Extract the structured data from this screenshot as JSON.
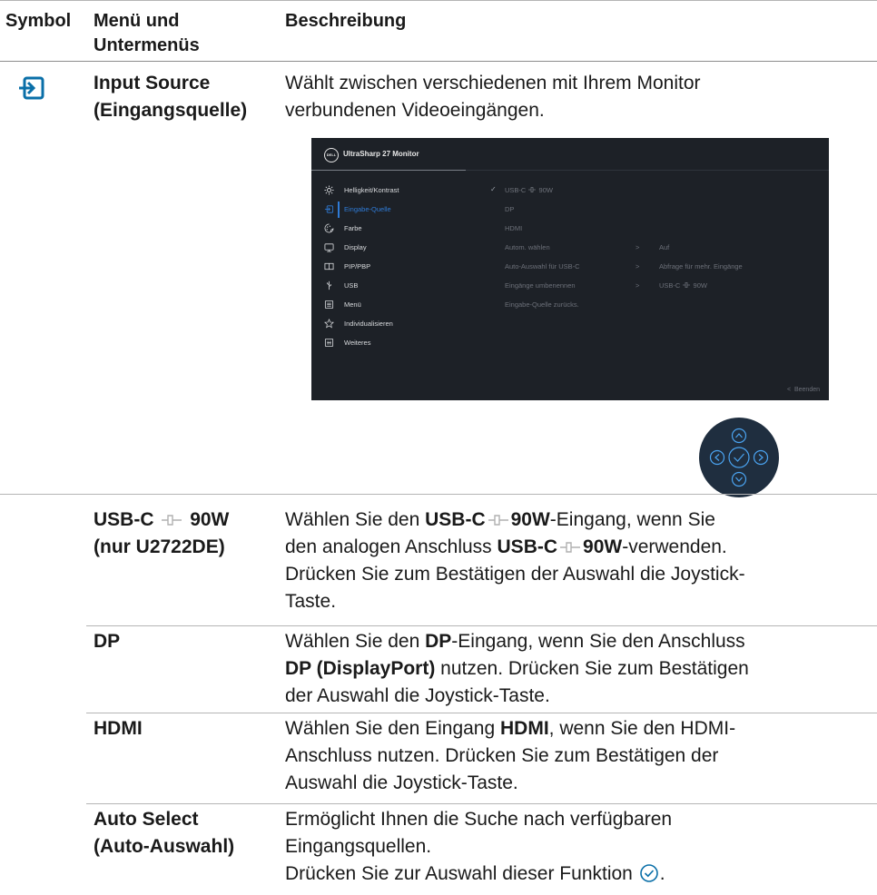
{
  "header": {
    "symbol": "Symbol",
    "menu_line1": "Menü und",
    "menu_line2": "Untermenüs",
    "description": "Beschreibung"
  },
  "rows": {
    "input_source": {
      "icon": "input-source-icon",
      "title_line1": "Input Source",
      "title_line2": "(Eingangsquelle)",
      "desc_line1": "Wählt zwischen verschiedenen mit Ihrem Monitor",
      "desc_line2": "verbundenen Videoeingängen."
    },
    "usbc": {
      "title_a": "USB-C",
      "title_b": "90W",
      "title_line2": "(nur U2722DE)",
      "d1_a": "Wählen Sie den ",
      "d1_b": "USB-C",
      "d1_c": "90W",
      "d1_d": "-Eingang, wenn Sie",
      "d2_a": "den analogen Anschluss ",
      "d2_b": "USB-C",
      "d2_c": "90W",
      "d2_d": "-verwenden.",
      "d3": "Drücken Sie zum Bestätigen der Auswahl die Joystick-",
      "d4": "Taste."
    },
    "dp": {
      "title": "DP",
      "d1_a": "Wählen Sie den ",
      "d1_b": "DP",
      "d1_c": "-Eingang, wenn Sie den Anschluss",
      "d2_a": "DP (DisplayPort)",
      "d2_b": " nutzen. Drücken Sie zum Bestätigen",
      "d3": "der Auswahl die Joystick-Taste."
    },
    "hdmi": {
      "title": "HDMI",
      "d1_a": "Wählen Sie den Eingang ",
      "d1_b": "HDMI",
      "d1_c": ", wenn Sie den HDMI-",
      "d2": "Anschluss nutzen. Drücken Sie zum Bestätigen der",
      "d3": "Auswahl die Joystick-Taste."
    },
    "auto_select": {
      "title_line1": "Auto Select",
      "title_line2": "(Auto-Auswahl)",
      "d1": "Ermöglicht Ihnen die Suche nach verfügbaren",
      "d2": "Eingangsquellen.",
      "d3_a": "Drücken Sie zur Auswahl dieser Funktion ",
      "d3_b": "."
    }
  },
  "osd": {
    "logo": "DELL",
    "title": "UltraSharp 27 Monitor",
    "menu": [
      {
        "label": "Helligkeit/Kontrast",
        "icon": "brightness-icon"
      },
      {
        "label": "Eingabe-Quelle",
        "icon": "input-icon"
      },
      {
        "label": "Farbe",
        "icon": "color-icon"
      },
      {
        "label": "Display",
        "icon": "display-icon"
      },
      {
        "label": "PIP/PBP",
        "icon": "pip-icon"
      },
      {
        "label": "USB",
        "icon": "usb-icon"
      },
      {
        "label": "Menü",
        "icon": "menu-icon"
      },
      {
        "label": "Individualisieren",
        "icon": "star-icon"
      },
      {
        "label": "Weiteres",
        "icon": "info-icon"
      }
    ],
    "active_index": 1,
    "sub": {
      "usbc": "USB-C",
      "usbc_power": "90W",
      "dp": "DP",
      "hdmi": "HDMI",
      "auto_select": "Autom. wählen",
      "auto_select_val": "Auf",
      "auto_usbc": "Auto-Auswahl für USB-C",
      "auto_usbc_val": "Abfrage für mehr. Eingänge",
      "rename": "Eingänge umbenennen",
      "rename_val_a": "USB-C",
      "rename_val_b": "90W",
      "reset": "Eingabe-Quelle zurücks."
    },
    "exit": "Beenden"
  },
  "colors": {
    "accent": "#0a6fa8",
    "osd_bg": "#1d2127",
    "osd_active": "#2f7bd6",
    "joystick_bg": "#1f2e3f",
    "joystick_line": "#4aa3f0"
  }
}
